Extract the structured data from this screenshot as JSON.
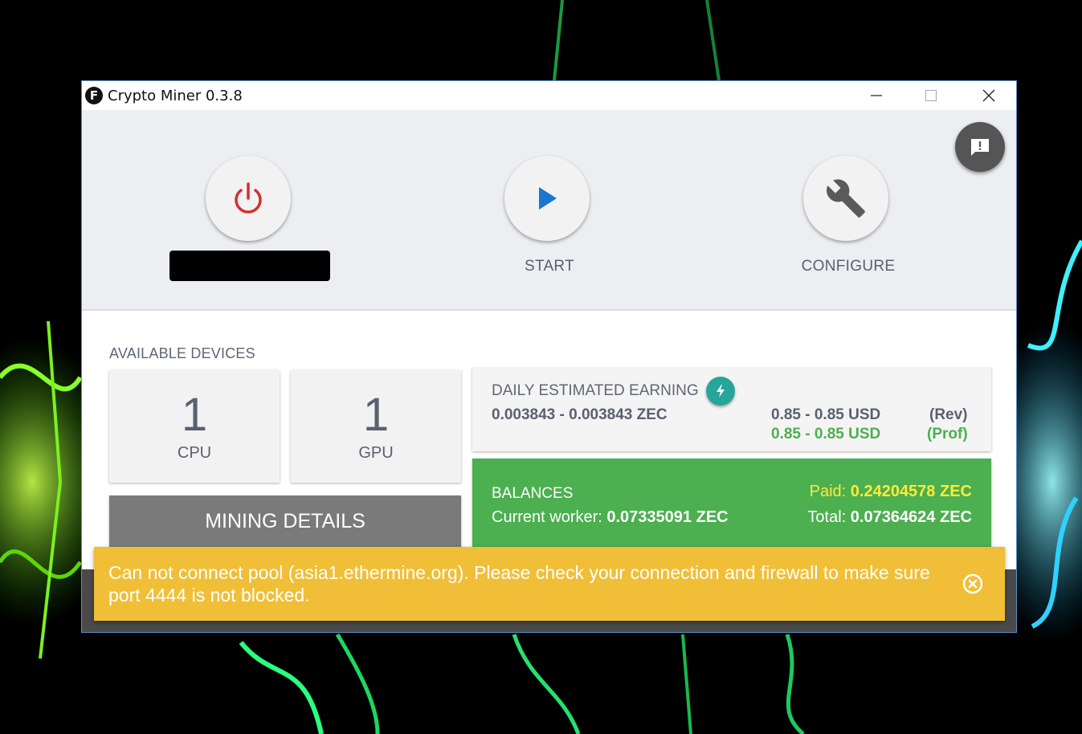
{
  "window": {
    "title": "Crypto Miner 0.3.8",
    "logo_letter": "F"
  },
  "toolbar": {
    "power_button": {
      "icon": "power-icon",
      "color": "#d32f2f"
    },
    "start_button": {
      "icon": "play-icon",
      "label": "START",
      "color": "#1976d2"
    },
    "configure_button": {
      "icon": "wrench-icon",
      "label": "CONFIGURE"
    },
    "feedback_button": {
      "icon": "feedback-icon"
    }
  },
  "devices": {
    "title": "AVAILABLE DEVICES",
    "items": [
      {
        "count": "1",
        "label": "CPU"
      },
      {
        "count": "1",
        "label": "GPU"
      }
    ],
    "mining_details_label": "MINING DETAILS"
  },
  "earning": {
    "title": "DAILY ESTIMATED EARNING",
    "zec_range": "0.003843 - 0.003843 ZEC",
    "usd_revenue": "0.85 - 0.85 USD",
    "revenue_tag": "(Rev)",
    "usd_profit": "0.85 - 0.85 USD",
    "profit_tag": "(Prof)"
  },
  "balances": {
    "title": "BALANCES",
    "worker_label": "Current worker:",
    "worker_value": "0.07335091 ZEC",
    "paid_label": "Paid:",
    "paid_value": "0.24204578 ZEC",
    "total_label": "Total:",
    "total_value": "0.07364624 ZEC"
  },
  "alert": {
    "message": "Can not connect pool (asia1.ethermine.org). Please check your connection and firewall to make sure port 4444 is not blocked.",
    "color": "#f0bf37"
  }
}
